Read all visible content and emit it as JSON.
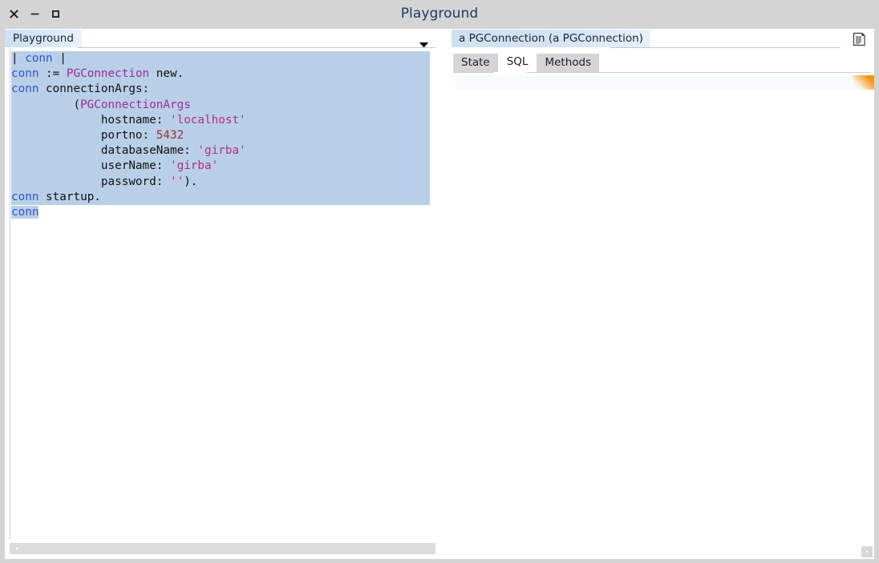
{
  "window": {
    "title": "Playground",
    "buttons": [
      {
        "name": "close",
        "glyph": "×"
      },
      {
        "name": "minimize",
        "glyph": "−"
      },
      {
        "name": "maximize",
        "glyph": "□"
      }
    ]
  },
  "left_pane": {
    "tab_label": "Playground",
    "dropdown_icon": "chevron-down-icon",
    "code_lines": [
      {
        "selected": true,
        "tokens": [
          {
            "t": "| ",
            "c": "pln"
          },
          {
            "t": "conn",
            "c": "var"
          },
          {
            "t": " |",
            "c": "pln"
          }
        ]
      },
      {
        "selected": true,
        "tokens": [
          {
            "t": "conn",
            "c": "var"
          },
          {
            "t": " := ",
            "c": "pln"
          },
          {
            "t": "PGConnection",
            "c": "cls"
          },
          {
            "t": " new.",
            "c": "pln"
          }
        ]
      },
      {
        "selected": true,
        "tokens": [
          {
            "t": "conn",
            "c": "var"
          },
          {
            "t": " connectionArgs:",
            "c": "pln"
          }
        ]
      },
      {
        "selected": true,
        "tokens": [
          {
            "t": "         (",
            "c": "pln"
          },
          {
            "t": "PGConnectionArgs",
            "c": "cls"
          }
        ]
      },
      {
        "selected": true,
        "tokens": [
          {
            "t": "             hostname: ",
            "c": "pln"
          },
          {
            "t": "'localhost'",
            "c": "str"
          }
        ]
      },
      {
        "selected": true,
        "tokens": [
          {
            "t": "             portno: ",
            "c": "pln"
          },
          {
            "t": "5432",
            "c": "num"
          }
        ]
      },
      {
        "selected": true,
        "tokens": [
          {
            "t": "             databaseName: ",
            "c": "pln"
          },
          {
            "t": "'girba'",
            "c": "str"
          }
        ]
      },
      {
        "selected": true,
        "tokens": [
          {
            "t": "             userName: ",
            "c": "pln"
          },
          {
            "t": "'girba'",
            "c": "str"
          }
        ]
      },
      {
        "selected": true,
        "tokens": [
          {
            "t": "             password: ",
            "c": "pln"
          },
          {
            "t": "''",
            "c": "str"
          },
          {
            "t": ").",
            "c": "pln"
          }
        ]
      },
      {
        "selected": true,
        "tokens": [
          {
            "t": "conn",
            "c": "var"
          },
          {
            "t": " startup.",
            "c": "pln"
          }
        ]
      },
      {
        "selected": false,
        "tokens": [
          {
            "t": "conn",
            "c": "var",
            "sel": true
          }
        ]
      }
    ],
    "scrollbar": "horizontal-scrollbar"
  },
  "right_pane": {
    "tab_label": "a PGConnection (a PGConnection)",
    "doc_icon": "document-list-icon",
    "subtabs": [
      {
        "label": "State",
        "active": false
      },
      {
        "label": "SQL",
        "active": true
      },
      {
        "label": "Methods",
        "active": false
      }
    ],
    "sql_panel": {
      "content": "",
      "corner_indicator": "orange-corner-indicator"
    }
  },
  "colors": {
    "chrome": "#d4d4d4",
    "selection": "#b9cfe8",
    "tab_active_blue": "#cfe0f2",
    "subtab_inactive": "#d5d5d5",
    "accent_orange": "#f79410",
    "title_text": "#1b3a5c",
    "code_variable": "#3355cc",
    "code_class": "#9b2b9b",
    "code_string": "#b03080",
    "code_number": "#99302e"
  }
}
